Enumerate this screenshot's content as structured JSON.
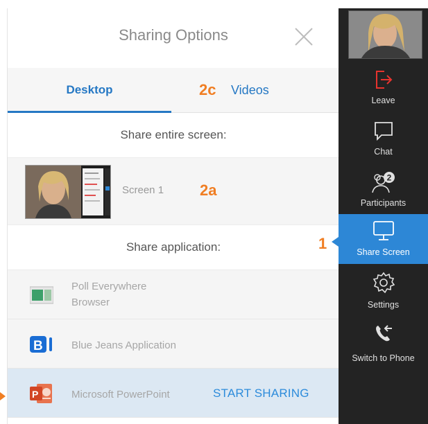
{
  "dialog": {
    "title": "Sharing Options"
  },
  "tabs": [
    {
      "label": "Desktop",
      "active": true
    },
    {
      "label": "Videos",
      "callout": "2c"
    }
  ],
  "desktop": {
    "entire_screen_heading": "Share entire screen:",
    "screens": [
      {
        "label": "Screen 1",
        "callout": "2a"
      }
    ],
    "application_heading": "Share application:",
    "applications": [
      {
        "name": "Poll Everywhere\nBrowser",
        "icon": "poll-everywhere-icon"
      },
      {
        "name": "Blue Jeans Application",
        "icon": "bluejeans-icon"
      },
      {
        "name": "Microsoft PowerPoint",
        "icon": "powerpoint-icon",
        "selected": true,
        "action_label": "START SHARING"
      }
    ]
  },
  "sidebar": {
    "items": [
      {
        "label": "Leave",
        "icon": "leave-icon"
      },
      {
        "label": "Chat",
        "icon": "chat-icon"
      },
      {
        "label": "Participants",
        "icon": "participants-icon",
        "badge": "2"
      },
      {
        "label": "Share Screen",
        "icon": "monitor-icon",
        "active": true,
        "callout": "1"
      },
      {
        "label": "Settings",
        "icon": "gear-icon"
      },
      {
        "label": "Switch to Phone",
        "icon": "phone-icon"
      }
    ]
  },
  "colors": {
    "accent_blue": "#2578c4",
    "callout_orange": "#f07e23",
    "sidebar_bg": "#232323",
    "active_bg": "#2d87d6",
    "leave_red": "#e8332e"
  }
}
